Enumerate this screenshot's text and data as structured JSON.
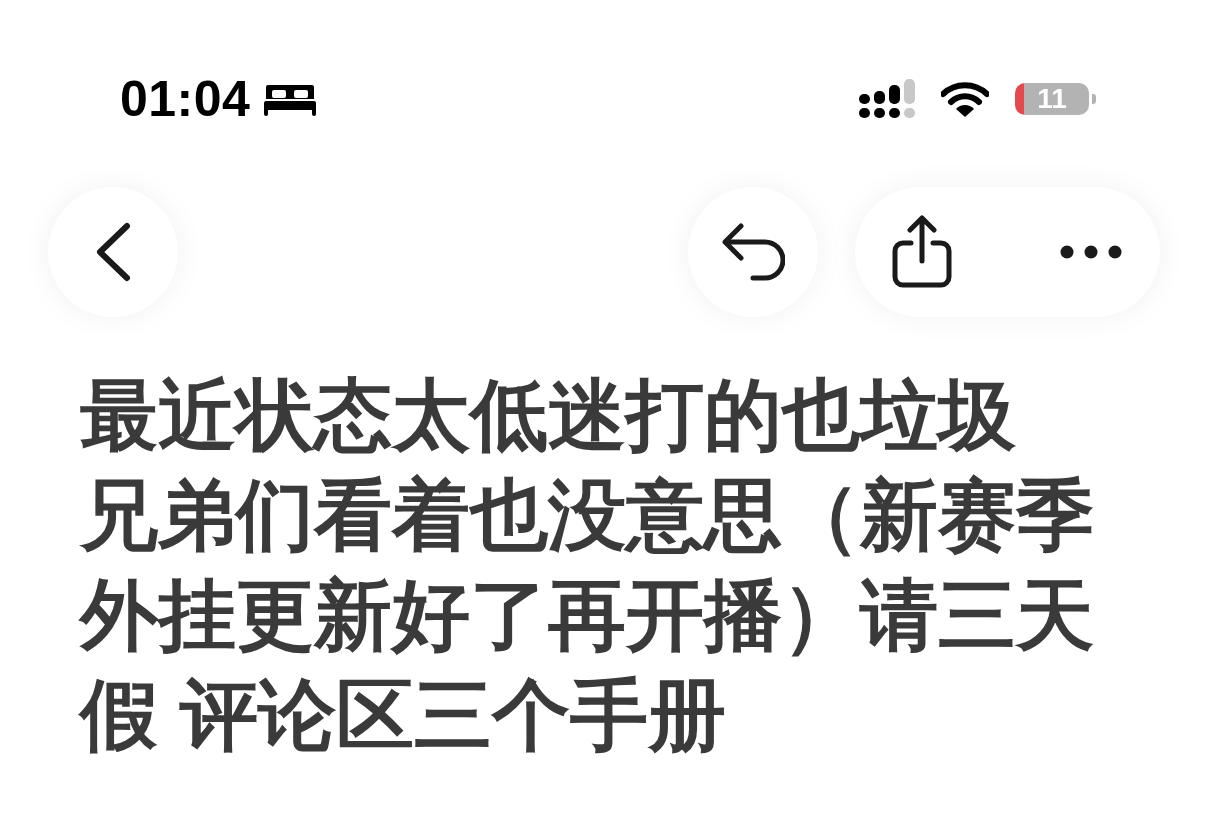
{
  "status_bar": {
    "time": "01:04",
    "battery": "11"
  },
  "post": {
    "title_lines": [
      "最近状态太低迷打的也垃圾",
      "兄弟们看着也没意思（新赛季外挂更新好了再开播）请三天假 评论区三个手册"
    ]
  }
}
